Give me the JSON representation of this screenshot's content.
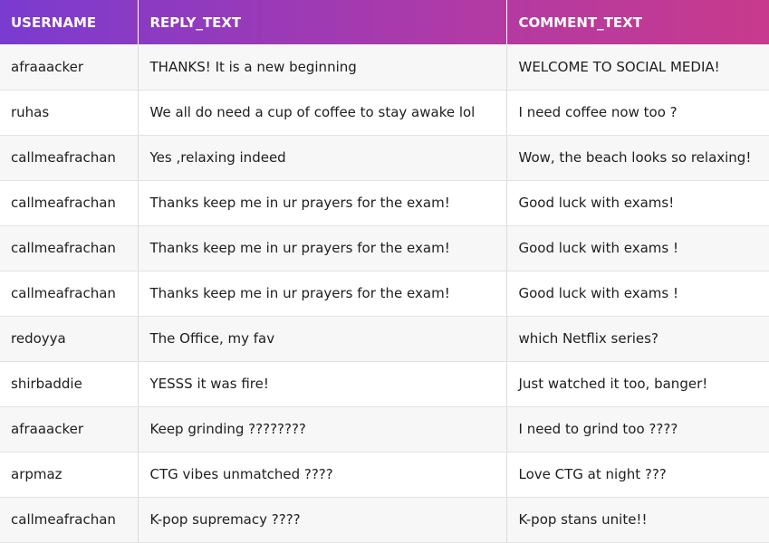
{
  "table": {
    "columns": [
      "USERNAME",
      "REPLY_TEXT",
      "COMMENT_TEXT"
    ],
    "rows": [
      {
        "username": "afraaacker",
        "reply_text": "THANKS! It is a new beginning",
        "comment_text": "WELCOME TO SOCIAL MEDIA!"
      },
      {
        "username": "ruhas",
        "reply_text": "We all do need a cup of coffee to stay awake lol",
        "comment_text": "I need coffee now too ?"
      },
      {
        "username": "callmeafrachan",
        "reply_text": "Yes ,relaxing indeed",
        "comment_text": "Wow, the beach looks so relaxing!"
      },
      {
        "username": "callmeafrachan",
        "reply_text": "Thanks keep me in ur prayers for the exam!",
        "comment_text": "Good luck with exams!"
      },
      {
        "username": "callmeafrachan",
        "reply_text": "Thanks keep me in ur prayers for the exam!",
        "comment_text": "Good luck with exams !"
      },
      {
        "username": "callmeafrachan",
        "reply_text": "Thanks keep me in ur prayers for the exam!",
        "comment_text": "Good luck with exams !"
      },
      {
        "username": "redoyya",
        "reply_text": "The Office, my fav",
        "comment_text": "which Netflix series?"
      },
      {
        "username": "shirbaddie",
        "reply_text": "YESSS it was fire!",
        "comment_text": "Just watched it too, banger!"
      },
      {
        "username": "afraaacker",
        "reply_text": "Keep grinding ????????",
        "comment_text": "I need to grind too ????"
      },
      {
        "username": "arpmaz",
        "reply_text": "CTG vibes unmatched ????",
        "comment_text": "Love CTG at night ???"
      },
      {
        "username": "callmeafrachan",
        "reply_text": "K-pop supremacy ????",
        "comment_text": "K-pop stans unite!!"
      }
    ]
  },
  "colors": {
    "header_gradient_start": "#7a3bd0",
    "header_gradient_end": "#c83a8c",
    "row_alt": "#f7f7f7",
    "row_base": "#ffffff"
  }
}
